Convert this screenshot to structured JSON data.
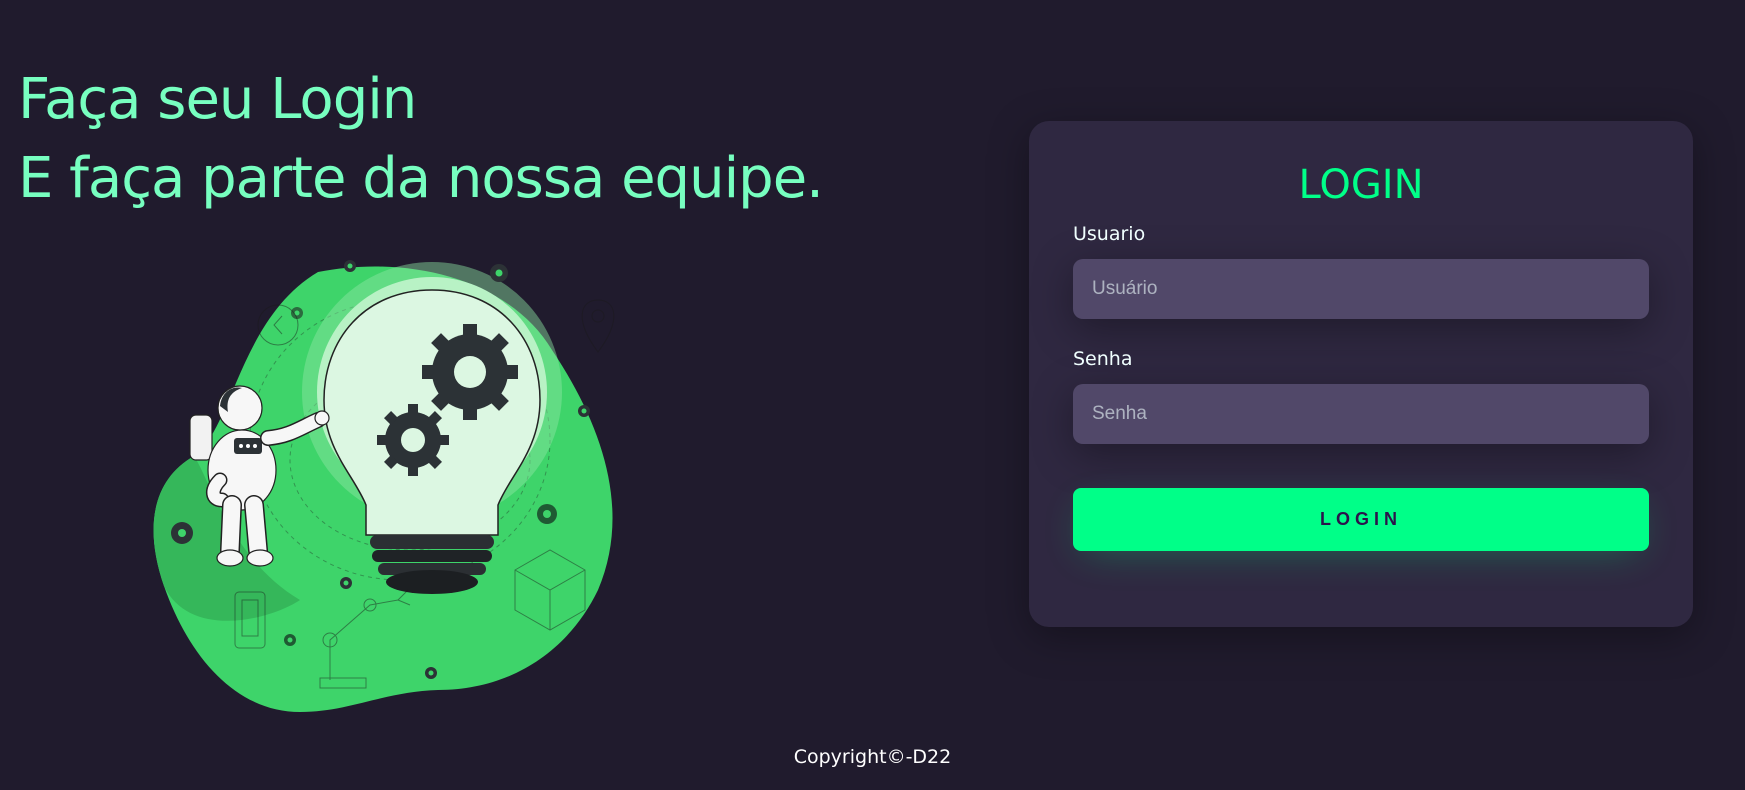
{
  "hero": {
    "line1": "Faça seu Login",
    "line2": "E faça parte da nossa equipe."
  },
  "illustration": {
    "name": "lightbulb-gears-astronaut-illustration"
  },
  "login": {
    "heading": "LOGIN",
    "username_label": "Usuario",
    "username_placeholder": "Usuário",
    "password_label": "Senha",
    "password_placeholder": "Senha",
    "button_label": "LOGIN"
  },
  "footer": {
    "copyright": "Copyright©-D22"
  },
  "colors": {
    "background": "#201b2d",
    "card": "#2f2841",
    "input": "#514869",
    "accent": "#00ff88",
    "hero_text": "#77ffc0",
    "blob_green": "#3ed46a"
  }
}
